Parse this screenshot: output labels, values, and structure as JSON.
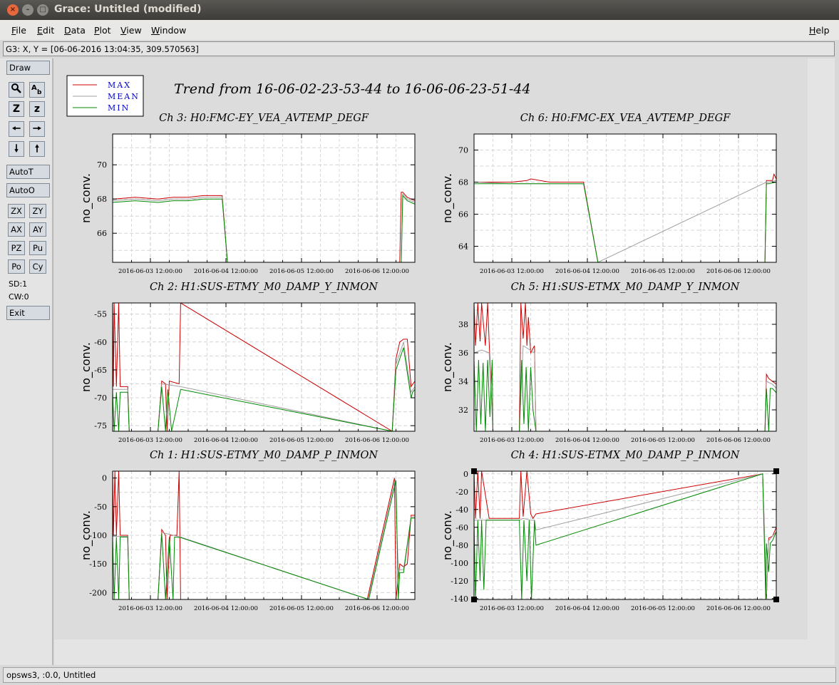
{
  "window": {
    "title": "Grace: Untitled (modified)"
  },
  "menubar": {
    "items": [
      "File",
      "Edit",
      "Data",
      "Plot",
      "View",
      "Window"
    ],
    "help": "Help"
  },
  "coord_readout": "G3: X, Y = [06-06-2016 13:04:35, 309.570563]",
  "toolbar": {
    "draw": "Draw",
    "autot": "AutoT",
    "autoo": "AutoO",
    "zx": "ZX",
    "zy": "ZY",
    "ax": "AX",
    "ay": "AY",
    "pz": "PZ",
    "pu": "Pu",
    "po": "Po",
    "cy": "Cy",
    "z_big": "Z",
    "z_small": "z",
    "sd": "SD:1",
    "cw": "CW:0",
    "exit": "Exit"
  },
  "status": "opsws3, :0.0, Untitled",
  "colors": {
    "max": "#cc0000",
    "mean": "#a0a0a0",
    "min": "#008800",
    "label_blue": "#0000cc"
  },
  "chart_data": {
    "title": "Trend from 16-06-02-23-53-44 to 16-06-06-23-51-44",
    "legend": {
      "placement": "top-left",
      "entries": [
        "MAX",
        "MEAN",
        "MIN"
      ]
    },
    "x_ticks": [
      "2016-06-03 12:00:00",
      "2016-06-04 12:00:00",
      "2016-06-05 12:00:00",
      "2016-06-06 12:00:00"
    ],
    "plots": [
      {
        "title": "Ch 3: H0:FMC-EY_VEA_AVTEMP_DEGF",
        "ylabel": "no_conv.",
        "type": "line",
        "ylim": [
          64.3,
          71.8
        ],
        "yticks": [
          66,
          68,
          70
        ],
        "series": [
          {
            "name": "MAX",
            "x": [
              2.0,
              2.02,
              2.3,
              2.6,
              2.8,
              3.0,
              3.2,
              3.45,
              3.52,
              3.8,
              5.8,
              5.82,
              5.84,
              5.9,
              6.0
            ],
            "y": [
              68.0,
              68.0,
              68.1,
              68.0,
              68.1,
              68.1,
              68.2,
              68.2,
              64.3,
              64.3,
              64.3,
              68.4,
              68.4,
              68.1,
              67.9
            ]
          },
          {
            "name": "MEAN",
            "x": [
              2.0,
              2.3,
              2.6,
              2.8,
              3.0,
              3.2,
              3.45,
              3.52,
              5.82,
              5.84,
              5.9,
              6.0
            ],
            "y": [
              67.9,
              68.0,
              67.9,
              68.0,
              68.0,
              68.1,
              68.1,
              64.3,
              64.3,
              68.3,
              68.0,
              67.8
            ]
          },
          {
            "name": "MIN",
            "x": [
              2.0,
              2.3,
              2.6,
              2.8,
              3.0,
              3.2,
              3.45,
              3.52,
              5.82,
              5.84,
              5.9,
              6.0
            ],
            "y": [
              67.8,
              67.9,
              67.8,
              67.9,
              67.9,
              68.0,
              68.0,
              64.3,
              64.3,
              68.2,
              67.9,
              67.7
            ]
          }
        ]
      },
      {
        "title": "Ch 6: H0:FMC-EX_VEA_AVTEMP_DEGF",
        "ylabel": "no_conv.",
        "type": "line",
        "ylim": [
          63.0,
          71.0
        ],
        "yticks": [
          64,
          66,
          68,
          70
        ],
        "series": [
          {
            "name": "MAX",
            "x": [
              2.0,
              2.5,
              2.7,
              2.75,
              3.0,
              3.45,
              3.64,
              5.85,
              5.87,
              5.95,
              5.97,
              6.0
            ],
            "y": [
              68.0,
              68.0,
              68.1,
              68.2,
              68.0,
              68.0,
              63.0,
              63.0,
              68.1,
              68.1,
              68.5,
              68.2
            ]
          },
          {
            "name": "MEAN",
            "x": [
              2.0,
              2.5,
              3.0,
              3.45,
              3.64,
              5.87,
              5.9,
              6.0
            ],
            "y": [
              68.0,
              67.9,
              67.9,
              67.9,
              63.0,
              68.0,
              68.0,
              68.1
            ]
          },
          {
            "name": "MIN",
            "x": [
              2.0,
              2.5,
              3.0,
              3.45,
              3.64,
              5.85,
              5.87,
              5.9,
              6.0
            ],
            "y": [
              67.9,
              67.9,
              67.9,
              67.9,
              63.0,
              63.0,
              67.9,
              67.9,
              68.0
            ]
          }
        ]
      },
      {
        "title": "Ch 2: H1:SUS-ETMY_M0_DAMP_Y_INMON",
        "ylabel": "no_conv.",
        "type": "line",
        "ylim": [
          -76,
          -53
        ],
        "yticks": [
          -75,
          -70,
          -65,
          -60,
          -55
        ],
        "series": [
          {
            "name": "MAX",
            "x": [
              2.0,
              2.01,
              2.02,
              2.05,
              2.08,
              2.1,
              2.2,
              2.22,
              2.6,
              2.65,
              2.7,
              2.72,
              2.75,
              2.88,
              2.9,
              5.7,
              5.75,
              5.8,
              5.85,
              5.9,
              5.95,
              6.0
            ],
            "y": [
              -53,
              -68,
              -53,
              -68,
              -53,
              -68,
              -68,
              -76,
              -76,
              -67,
              -67.5,
              -76,
              -67,
              -67.5,
              -53,
              -76,
              -63,
              -60,
              -59.5,
              -59.5,
              -68,
              -67
            ]
          },
          {
            "name": "MEAN",
            "x": [
              2.0,
              2.2,
              2.22,
              2.6,
              2.65,
              2.9,
              5.7,
              5.75,
              5.85,
              5.95,
              6.0
            ],
            "y": [
              -68.5,
              -68.5,
              -76,
              -76,
              -67.5,
              -68,
              -76,
              -64,
              -60,
              -69,
              -68
            ]
          },
          {
            "name": "MIN",
            "x": [
              2.0,
              2.02,
              2.05,
              2.08,
              2.1,
              2.2,
              2.22,
              2.6,
              2.65,
              2.7,
              2.73,
              2.78,
              2.9,
              5.7,
              5.75,
              5.85,
              5.95,
              5.97,
              6.0
            ],
            "y": [
              -69,
              -76,
              -69,
              -76,
              -69,
              -69,
              -76,
              -76,
              -68,
              -76,
              -68.5,
              -76,
              -68.5,
              -76,
              -65,
              -61,
              -70,
              -69,
              -68.5
            ]
          }
        ]
      },
      {
        "title": "Ch 5: H1:SUS-ETMX_M0_DAMP_Y_INMON",
        "ylabel": "no_conv.",
        "type": "line",
        "ylim": [
          30.5,
          39.5
        ],
        "yticks": [
          32,
          34,
          36,
          38
        ],
        "series": [
          {
            "name": "MAX",
            "x": [
              2.0,
              2.02,
              2.05,
              2.08,
              2.1,
              2.15,
              2.18,
              2.2,
              2.25,
              2.6,
              2.62,
              2.65,
              2.68,
              2.7,
              2.72,
              2.75,
              2.8,
              2.82,
              5.85,
              5.87,
              5.9,
              5.95,
              6.0
            ],
            "y": [
              39.5,
              36.5,
              39.5,
              36.8,
              39.5,
              36.5,
              39.5,
              36.8,
              30.5,
              30.5,
              39.5,
              37,
              39.5,
              36.5,
              38.5,
              36,
              36.5,
              30.5,
              30.5,
              34.5,
              34.2,
              34,
              33.8
            ]
          },
          {
            "name": "MEAN",
            "x": [
              2.0,
              2.1,
              2.2,
              2.25,
              2.6,
              2.65,
              2.8,
              2.82,
              5.85,
              5.87,
              5.95,
              6.0
            ],
            "y": [
              36,
              36.2,
              36,
              30.5,
              30.5,
              36.5,
              36,
              30.5,
              30.5,
              34,
              33.8,
              33.5
            ]
          },
          {
            "name": "MIN",
            "x": [
              2.0,
              2.03,
              2.06,
              2.09,
              2.12,
              2.15,
              2.18,
              2.21,
              2.24,
              2.25,
              2.6,
              2.63,
              2.66,
              2.69,
              2.72,
              2.75,
              2.78,
              2.82,
              5.85,
              5.87,
              5.9,
              5.92,
              5.95,
              6.0
            ],
            "y": [
              35.5,
              30.5,
              35.5,
              31,
              35.3,
              30.5,
              35.5,
              31.5,
              35.5,
              30.5,
              30.5,
              35.5,
              31,
              35,
              30.5,
              35,
              32,
              30.5,
              30.5,
              33.5,
              30.5,
              33.5,
              33.5,
              33.2
            ]
          }
        ]
      },
      {
        "title": "Ch 1: H1:SUS-ETMY_M0_DAMP_P_INMON",
        "ylabel": "no_conv.",
        "type": "line",
        "ylim": [
          -212,
          12
        ],
        "yticks": [
          -200,
          -150,
          -100,
          -50,
          0
        ],
        "series": [
          {
            "name": "MAX",
            "x": [
              2.0,
              2.01,
              2.03,
              2.05,
              2.08,
              2.1,
              2.2,
              2.22,
              2.6,
              2.65,
              2.7,
              2.72,
              2.76,
              2.85,
              2.88,
              2.9,
              5.37,
              5.73,
              5.75,
              5.8,
              5.85,
              5.9,
              5.95,
              6.0
            ],
            "y": [
              12,
              -100,
              12,
              -100,
              12,
              -100,
              -100,
              -212,
              -212,
              -90,
              -100,
              -212,
              -100,
              -100,
              12,
              -212,
              -212,
              0,
              -212,
              -150,
              -155,
              -150,
              -65,
              -65
            ]
          },
          {
            "name": "MEAN",
            "x": [
              2.0,
              2.2,
              2.22,
              2.6,
              2.65,
              2.9,
              5.38,
              5.74,
              5.78,
              5.85,
              5.95,
              6.0
            ],
            "y": [
              -102,
              -102,
              -212,
              -212,
              -95,
              -103,
              -212,
              -2,
              -160,
              -160,
              -68,
              -68
            ]
          },
          {
            "name": "MIN",
            "x": [
              2.0,
              2.02,
              2.05,
              2.08,
              2.1,
              2.2,
              2.22,
              2.6,
              2.65,
              2.7,
              2.75,
              2.8,
              2.82,
              2.9,
              5.39,
              5.75,
              5.78,
              5.8,
              5.85,
              5.95,
              6.0
            ],
            "y": [
              -103,
              -212,
              -103,
              -212,
              -103,
              -103,
              -212,
              -212,
              -97,
              -212,
              -103,
              -212,
              -103,
              -104,
              -212,
              -4,
              -212,
              -165,
              -165,
              -70,
              -70
            ]
          }
        ]
      },
      {
        "title": "Ch 4: H1:SUS-ETMX_M0_DAMP_P_INMON",
        "ylabel": "no_conv.",
        "type": "line",
        "ylim": [
          -141,
          3
        ],
        "yticks": [
          -140,
          -120,
          -100,
          -80,
          -60,
          -40,
          -20,
          0
        ],
        "series": [
          {
            "name": "MAX",
            "x": [
              2.0,
              2.02,
              2.05,
              2.08,
              2.1,
              2.2,
              2.6,
              2.62,
              2.65,
              2.7,
              2.75,
              2.78,
              2.82,
              5.82,
              5.87,
              5.9,
              5.95,
              6.0
            ],
            "y": [
              3,
              -50,
              3,
              -50,
              3,
              -50,
              -50,
              3,
              -48,
              3,
              -45,
              -50,
              -45,
              0,
              -140,
              -72,
              -70,
              -60
            ]
          },
          {
            "name": "MEAN",
            "x": [
              2.0,
              2.2,
              2.6,
              2.65,
              2.75,
              2.8,
              2.82,
              5.82,
              5.87,
              5.9,
              6.0
            ],
            "y": [
              -52,
              -52,
              -52,
              -50,
              -52,
              -52,
              -63,
              0,
              -135,
              -75,
              -65
            ]
          },
          {
            "name": "MIN",
            "x": [
              2.0,
              2.02,
              2.05,
              2.08,
              2.1,
              2.13,
              2.16,
              2.2,
              2.6,
              2.63,
              2.66,
              2.7,
              2.73,
              2.76,
              2.8,
              2.82,
              5.82,
              5.86,
              5.87,
              5.9,
              5.92,
              5.95,
              6.0
            ],
            "y": [
              -52,
              -141,
              -52,
              -120,
              -52,
              -130,
              -52,
              -52,
              -52,
              -141,
              -52,
              -120,
              -52,
              -141,
              -52,
              -80,
              0,
              -141,
              -78,
              -110,
              -78,
              -75,
              -65
            ]
          }
        ]
      }
    ]
  }
}
